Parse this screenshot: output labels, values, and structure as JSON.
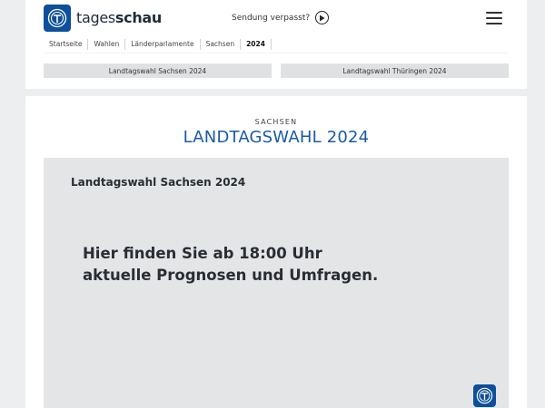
{
  "header": {
    "brand_light": "tages",
    "brand_bold": "schau",
    "missed_label": "Sendung verpasst?",
    "icons": {
      "logo": "tagesschau-logo",
      "play": "play-circle-icon",
      "menu": "hamburger-menu-icon"
    }
  },
  "breadcrumbs": [
    "Startseite",
    "Wahlen",
    "Länderparlamente",
    "Sachsen",
    "2024"
  ],
  "tabs": [
    "Landtagswahl Sachsen 2024",
    "Landtagswahl Thüringen 2024"
  ],
  "main": {
    "kicker": "SACHSEN",
    "title": "LANDTAGSWAHL 2024",
    "stage_title": "Landtagswahl Sachsen 2024",
    "stage_message_line1": "Hier finden Sie ab 18:00 Uhr",
    "stage_message_line2": "aktuelle Prognosen und Umfragen."
  },
  "colors": {
    "brand_blue": "#0d4f9a",
    "title_blue": "#1a5aa6",
    "background": "#eceef0"
  }
}
